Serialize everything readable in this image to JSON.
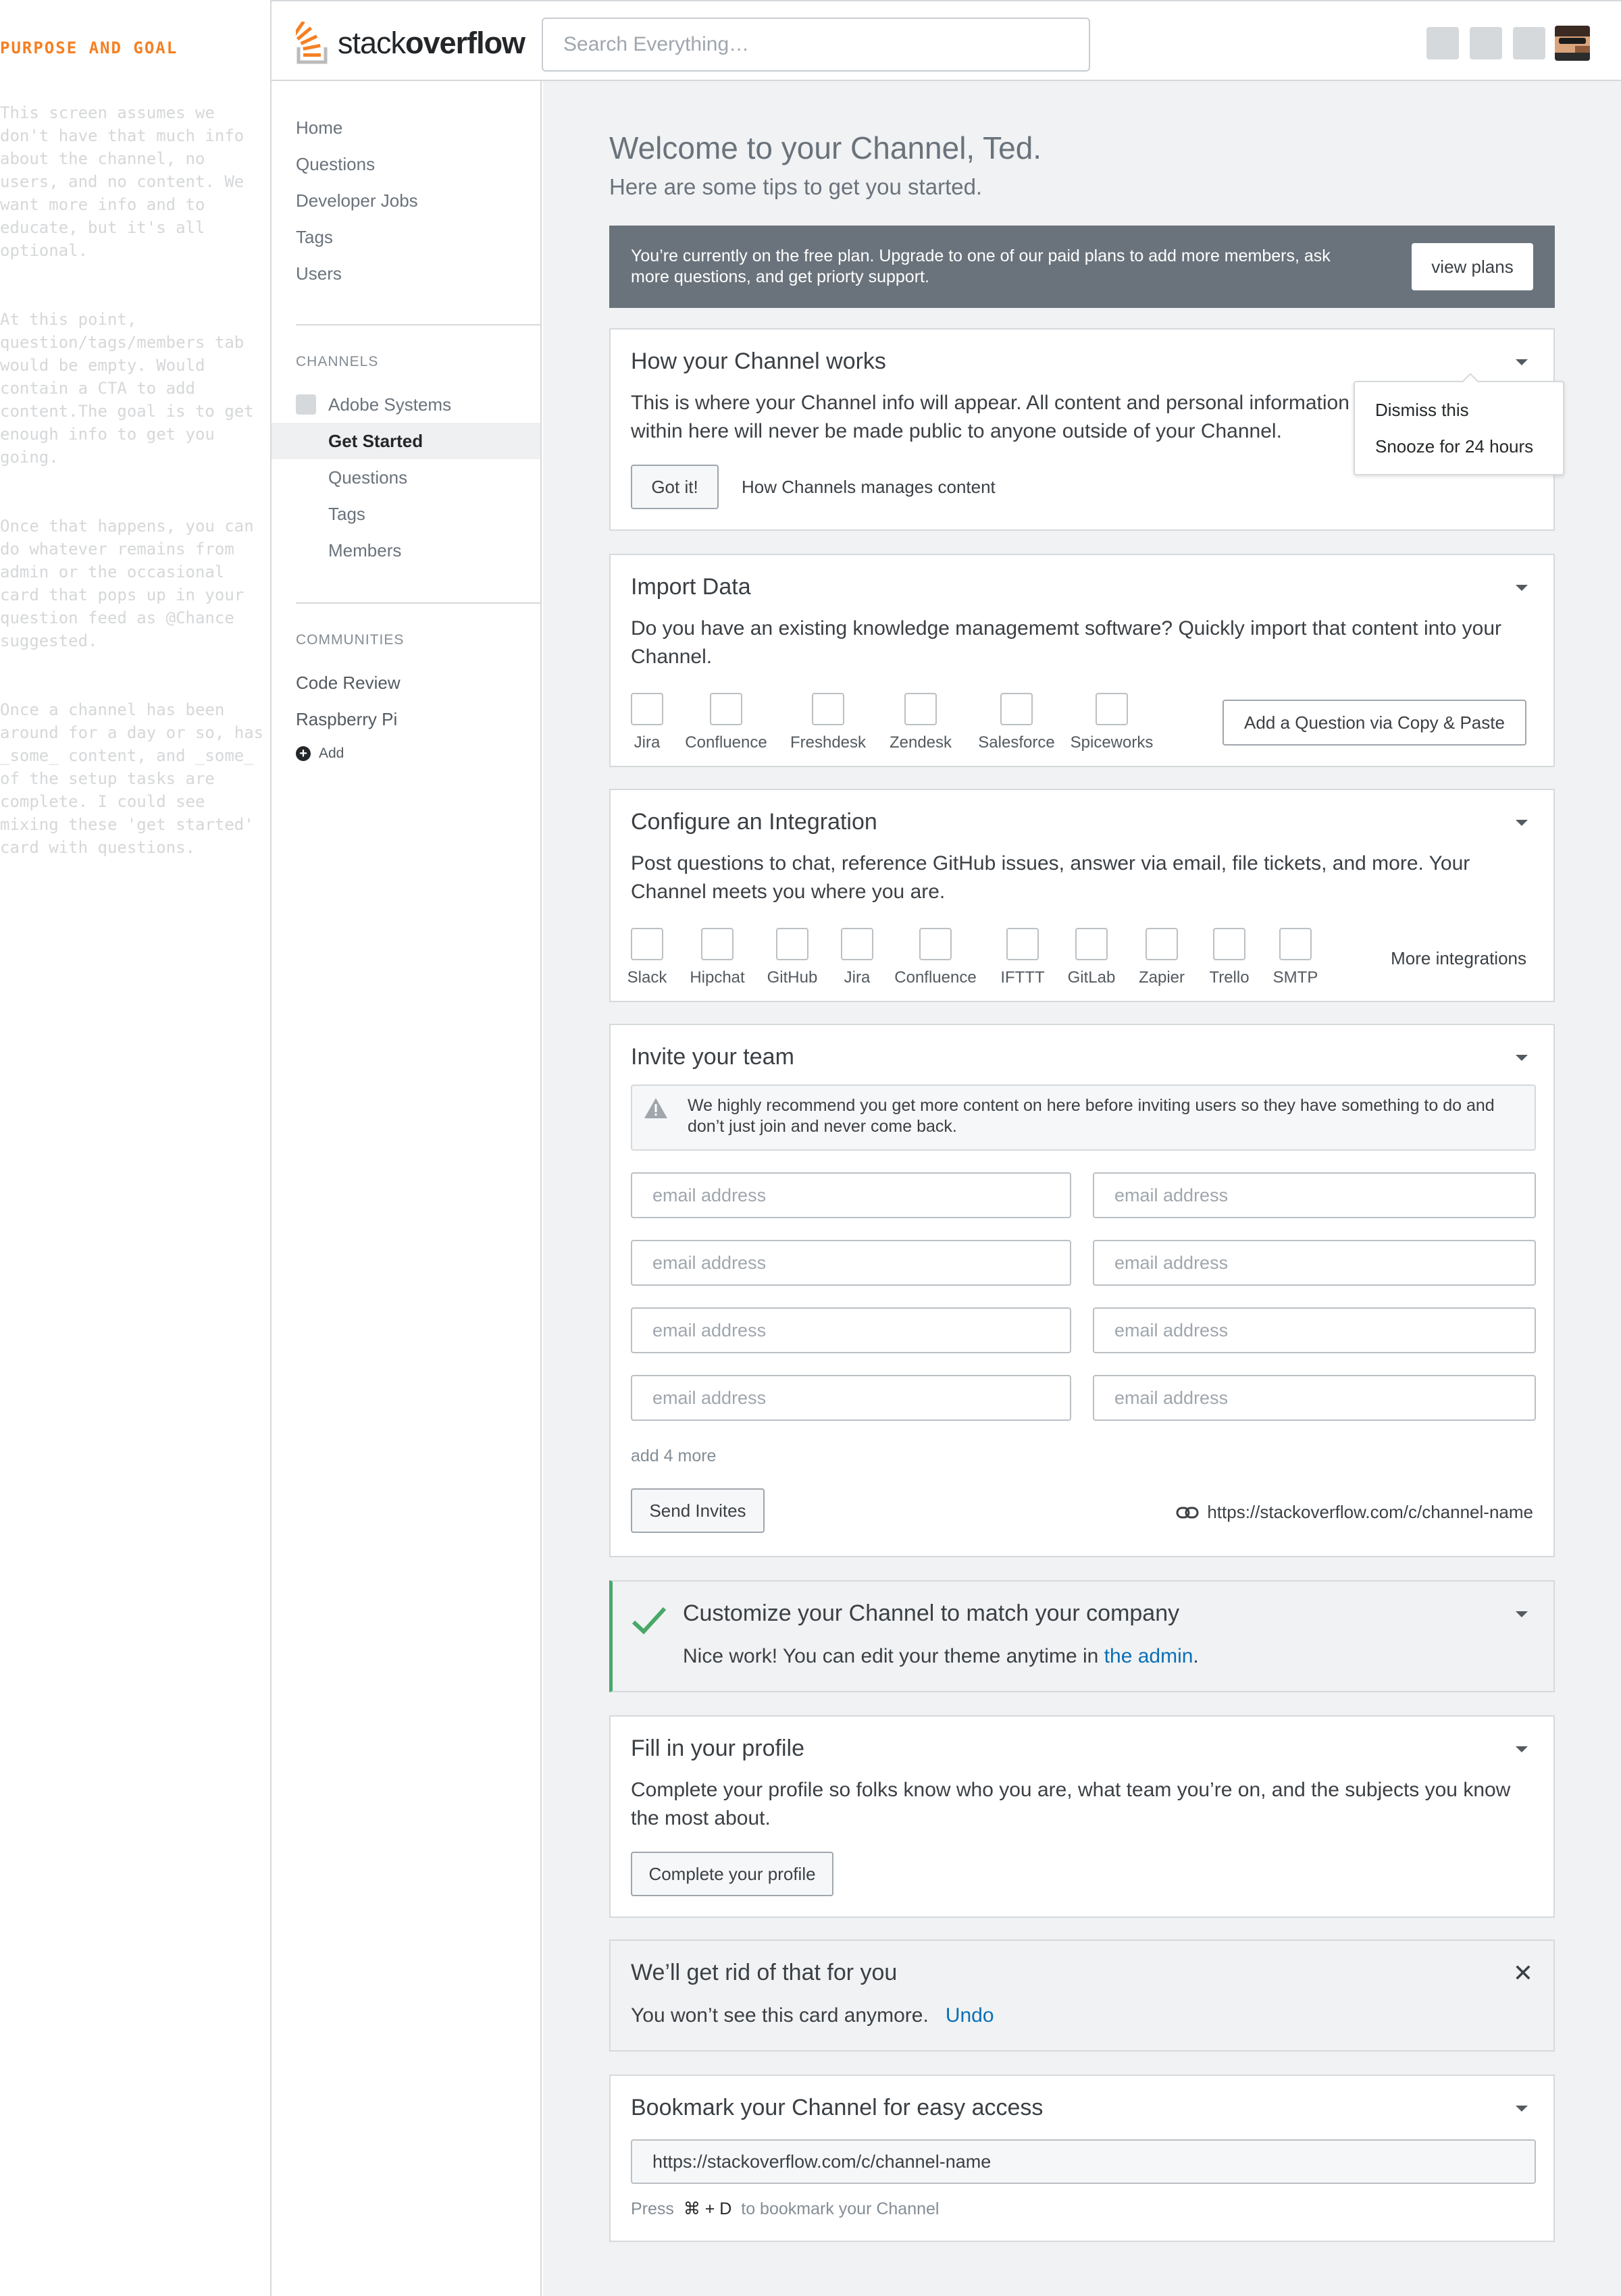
{
  "notes": {
    "heading": "PURPOSE AND GOAL",
    "paragraphs": [
      "This screen assumes we don't have that much info about the channel, no users, and no content. We want more info and to educate, but it's all optional.",
      "At this point, question/tags/members tab would be empty. Would contain a CTA to add content.The goal is to get enough info to get you going.",
      "Once that happens, you can do whatever remains from admin or the occasional card that pops up in your question feed as @Chance suggested.",
      "Once a channel has been around for a day or so, has _some_ content, and _some_ of  the setup tasks are complete. I could see mixing these 'get started' card with questions."
    ]
  },
  "header": {
    "logo_text_light": "stack",
    "logo_text_bold": "overflow",
    "search_placeholder": "Search Everything…"
  },
  "sidebar": {
    "nav": [
      "Home",
      "Questions",
      "Developer Jobs",
      "Tags",
      "Users"
    ],
    "channels_heading": "CHANNELS",
    "channel_name": "Adobe Systems",
    "channel_items": [
      "Get Started",
      "Questions",
      "Tags",
      "Members"
    ],
    "active_item": "Get Started",
    "communities_heading": "COMMUNITIES",
    "communities": [
      "Code Review",
      "Raspberry Pi"
    ],
    "add_label": "Add"
  },
  "welcome": {
    "title": "Welcome to your Channel, Ted.",
    "subtitle": "Here are some tips to get you started."
  },
  "banner": {
    "text": "You’re currently on the free plan. Upgrade to one of our paid plans to add more members, ask more questions, and get priorty support.",
    "button": "view plans"
  },
  "card_channel": {
    "title": "How your Channel works",
    "body": "This is where your Channel info will appear. All content and personal information within here will never be made public to anyone outside of your Channel.",
    "button": "Got it!",
    "link": "How Channels manages content",
    "menu": [
      "Dismiss this",
      "Snooze for 24 hours"
    ]
  },
  "card_import": {
    "title": "Import Data",
    "body": "Do you have an existing knowledge managememt software? Quickly import that content into your Channel.",
    "sources": [
      "Jira",
      "Confluence",
      "Freshdesk",
      "Zendesk",
      "Salesforce",
      "Spiceworks"
    ],
    "button": "Add a Question via Copy & Paste"
  },
  "card_integration": {
    "title": "Configure an Integration",
    "body": "Post questions to chat, reference GitHub issues, answer via email, file tickets, and more. Your Channel meets you where you are.",
    "integrations": [
      "Slack",
      "Hipchat",
      "GitHub",
      "Jira",
      "Confluence",
      "IFTTT",
      "GitLab",
      "Zapier",
      "Trello",
      "SMTP"
    ],
    "more": "More integrations"
  },
  "card_invite": {
    "title": "Invite your team",
    "warning": "We highly recommend you get more content on here before inviting users so they have something to do and don’t just join and never come back.",
    "email_placeholder": "email address",
    "add_more": "add 4 more",
    "button": "Send Invites",
    "url": "https://stackoverflow.com/c/channel-name"
  },
  "card_customize": {
    "title": "Customize your Channel to match your company",
    "body_prefix": "Nice work! You can edit your theme anytime in ",
    "body_link": "the admin",
    "body_suffix": ".",
    "check_color": "#48a868"
  },
  "card_profile": {
    "title": "Fill in your profile",
    "body": "Complete your profile so folks know who you are, what team you’re on, and the subjects you know the most about.",
    "button": "Complete your profile"
  },
  "card_dismissed": {
    "title": "We’ll get rid of that for you",
    "body": "You won’t see this card anymore.",
    "undo": "Undo"
  },
  "card_bookmark": {
    "title": "Bookmark your Channel for easy access",
    "url": "https://stackoverflow.com/c/channel-name",
    "hint_prefix": "Press",
    "shortcut": "⌘ + D",
    "hint_suffix": "to bookmark your Channel"
  },
  "colors": {
    "brand_orange": "#f48024",
    "banner_bg": "#6a737c",
    "link_blue": "#0a6fb5",
    "success_green": "#48a868"
  }
}
